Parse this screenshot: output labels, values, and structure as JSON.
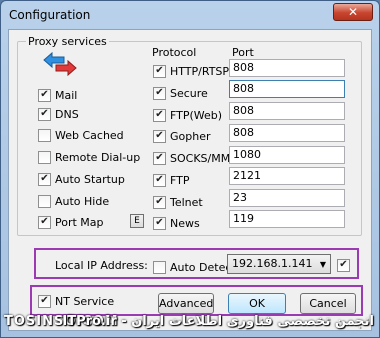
{
  "window": {
    "title": "Configuration",
    "close_glyph": "✕"
  },
  "proxy_group": {
    "label": "Proxy services"
  },
  "headers": {
    "protocol": "Protocol",
    "port": "Port"
  },
  "services": [
    {
      "label": "Mail",
      "checked": true
    },
    {
      "label": "DNS",
      "checked": true
    },
    {
      "label": "Web Cached",
      "checked": false
    },
    {
      "label": "Remote Dial-up",
      "checked": false
    },
    {
      "label": "Auto Startup",
      "checked": true
    },
    {
      "label": "Auto Hide",
      "checked": false
    },
    {
      "label": "Port Map",
      "checked": true
    }
  ],
  "port_map_button": "E",
  "protocols": [
    {
      "label": "HTTP/RTSP",
      "checked": true,
      "port": "808"
    },
    {
      "label": "Secure",
      "checked": true,
      "port": "808"
    },
    {
      "label": "FTP(Web)",
      "checked": true,
      "port": "808"
    },
    {
      "label": "Gopher",
      "checked": true,
      "port": "808"
    },
    {
      "label": "SOCKS/MMS",
      "checked": true,
      "port": "1080"
    },
    {
      "label": "FTP",
      "checked": true,
      "port": "2121"
    },
    {
      "label": "Telnet",
      "checked": true,
      "port": "23"
    },
    {
      "label": "News",
      "checked": true,
      "port": "119"
    }
  ],
  "local_ip": {
    "label": "Local IP Address:",
    "auto_detect_label": "Auto Detect",
    "auto_detect_checked": false,
    "selected": "192.168.1.141",
    "extra_checked": true
  },
  "bottom": {
    "nt_service_label": "NT Service",
    "nt_service_checked": true,
    "advanced": "Advanced",
    "ok": "OK",
    "cancel": "Cancel"
  },
  "watermark": {
    "left": "TOSINSO.COM",
    "right": "انجمن تخصصی فناوری اطلاعات ایران - ITPro.ir"
  },
  "icons": {
    "arrows": "left-right-arrows-icon",
    "accent_blue": "#3c7fb1",
    "highlight_purple": "#9b3bb4"
  }
}
